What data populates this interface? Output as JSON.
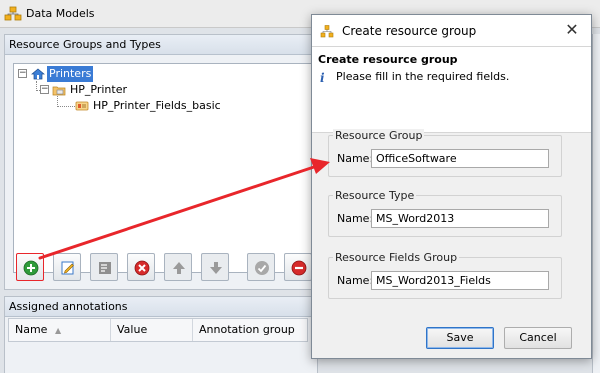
{
  "window": {
    "title": "Data Models",
    "icon": "data-models-icon"
  },
  "resource_panel": {
    "header": "Resource Groups and Types",
    "tree": [
      {
        "label": "Printers",
        "icon": "home-icon",
        "selected": true
      },
      {
        "label": "HP_Printer",
        "icon": "printer-group-icon"
      },
      {
        "label": "HP_Printer_Fields_basic",
        "icon": "fields-icon"
      }
    ]
  },
  "toolbar": [
    {
      "name": "add-button",
      "icon": "add-icon"
    },
    {
      "name": "edit-button",
      "icon": "edit-icon"
    },
    {
      "name": "properties-button",
      "icon": "properties-icon"
    },
    {
      "name": "delete-button",
      "icon": "delete-icon"
    },
    {
      "name": "move-up-button",
      "icon": "arrow-up-icon"
    },
    {
      "name": "move-down-button",
      "icon": "arrow-down-icon"
    },
    {
      "name": "validate-button",
      "icon": "check-icon"
    },
    {
      "name": "remove-button",
      "icon": "minus-icon"
    }
  ],
  "annotations_panel": {
    "header": "Assigned annotations",
    "columns": [
      "Name",
      "Value",
      "Annotation group"
    ]
  },
  "dialog": {
    "title": "Create resource group",
    "close": "✕",
    "heading": "Create resource group",
    "info_icon": "i",
    "info": "Please fill in the required fields.",
    "groups": [
      {
        "title": "Resource Group",
        "label": "Name:",
        "value": "OfficeSoftware"
      },
      {
        "title": "Resource Type",
        "label": "Name:",
        "value": "MS_Word2013"
      },
      {
        "title": "Resource Fields Group",
        "label": "Name:",
        "value": "MS_Word2013_Fields"
      }
    ],
    "save": "Save",
    "cancel": "Cancel"
  },
  "colors": {
    "annotation_arrow": "#e8262b",
    "selection": "#3a7bd5"
  }
}
